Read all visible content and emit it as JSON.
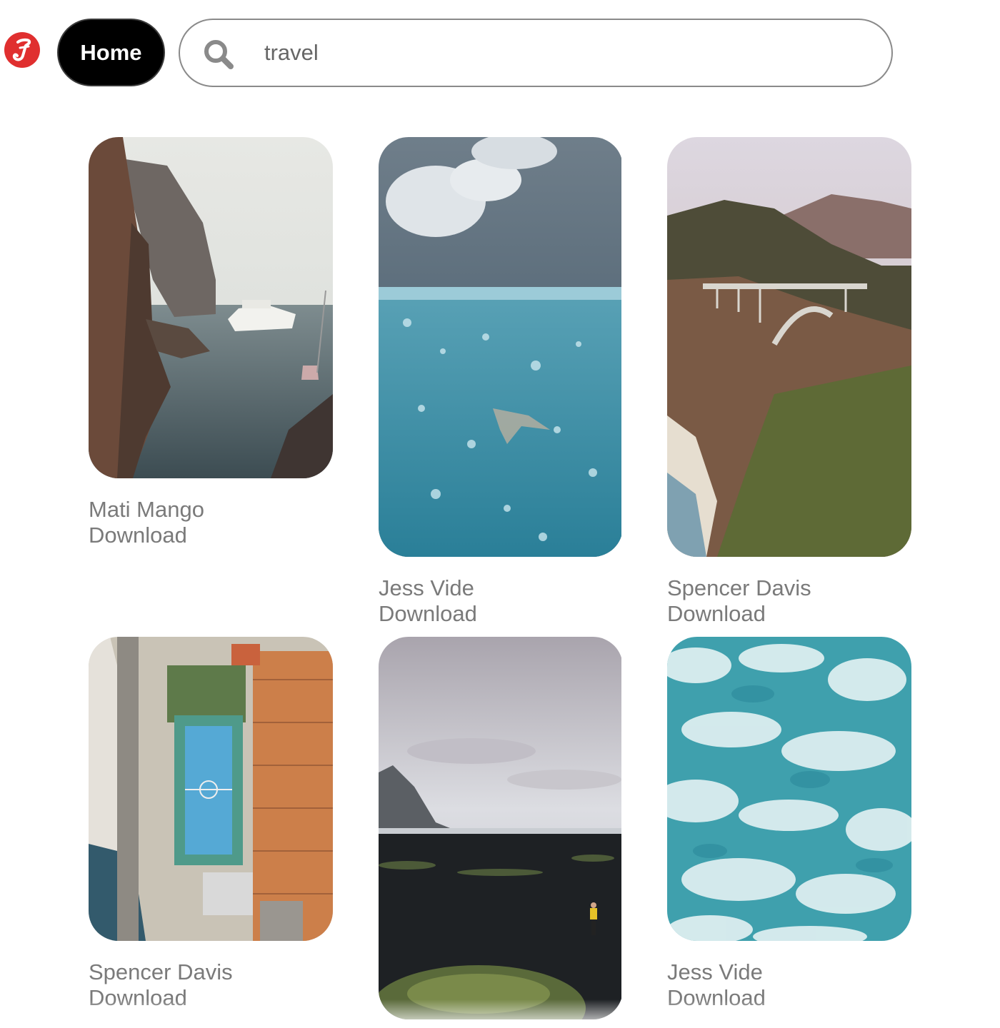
{
  "header": {
    "logo_icon": "script-j-logo-icon",
    "logo_color": "#e02f2f",
    "home_label": "Home",
    "search_icon": "search-icon",
    "search_value": "travel"
  },
  "pins": [
    {
      "author": "Mati Mango",
      "download_label": "Download",
      "image": "coastal cliffs with yacht and sailboat"
    },
    {
      "author": "Jess Vide",
      "download_label": "Download",
      "image": "underwater swimmer with bubbles"
    },
    {
      "author": "Spencer Davis",
      "download_label": "Download",
      "image": "arch bridge over coastal canyon"
    },
    {
      "author": "Spencer Davis",
      "download_label": "Download",
      "image": "aerial view of basketball court and rooftops"
    },
    {
      "author": "Jess Vide",
      "download_label": "Download",
      "image": "person in yellow jacket on black sand beach"
    },
    {
      "author": "Jess Vide",
      "download_label": "Download",
      "image": "aerial view of turquoise ocean foam"
    }
  ]
}
